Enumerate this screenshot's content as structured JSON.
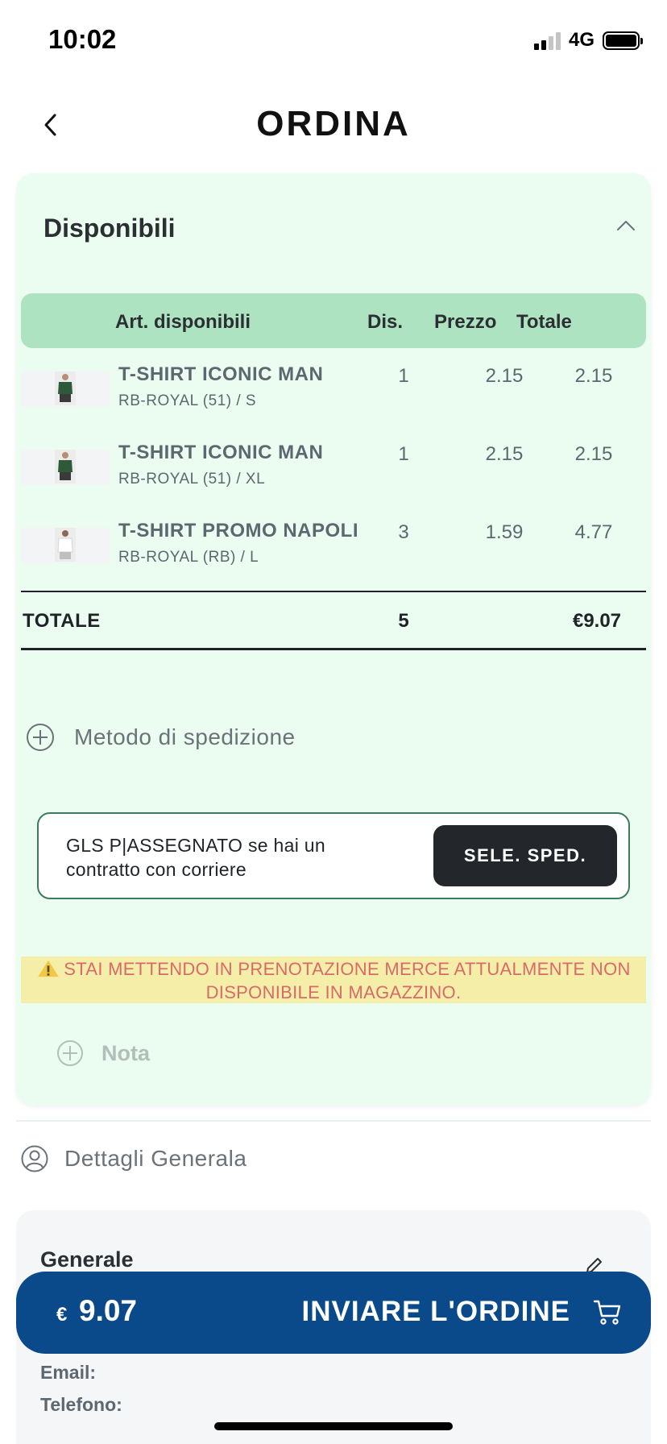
{
  "status_bar": {
    "time": "10:02",
    "network": "4G"
  },
  "header": {
    "title": "ORDINA"
  },
  "available": {
    "section_title": "Disponibili",
    "columns": {
      "article": "Art. disponibili",
      "dis": "Dis.",
      "price": "Prezzo",
      "total": "Totale"
    },
    "rows": [
      {
        "name": "T-SHIRT ICONIC MAN",
        "variant": "RB-ROYAL  (51) / S",
        "dis": "1",
        "price": "2.15",
        "total": "2.15"
      },
      {
        "name": "T-SHIRT ICONIC MAN",
        "variant": "RB-ROYAL  (51) / XL",
        "dis": "1",
        "price": "2.15",
        "total": "2.15"
      },
      {
        "name": "T-SHIRT PROMO NAPOLI",
        "variant": "RB-ROYAL  (RB) / L",
        "dis": "3",
        "price": "1.59",
        "total": "4.77"
      }
    ],
    "totals": {
      "label": "TOTALE",
      "qty": "5",
      "amount": "€9.07"
    }
  },
  "shipping": {
    "method_label": "Metodo di spedizione",
    "selected_text": "GLS P|ASSEGNATO se hai un contratto con corriere",
    "select_button": "SELE. SPED."
  },
  "warning": {
    "text": "STAI METTENDO IN PRENOTAZIONE MERCE ATTUALMENTE NON DISPONIBILE IN MAGAZZINO."
  },
  "note": {
    "label": "Nota"
  },
  "details": {
    "label": "Dettagli Generala",
    "card_title": "Generale",
    "email_label": "Email:",
    "phone_label": "Telefono:"
  },
  "order_bar": {
    "currency": "€",
    "amount": "9.07",
    "button_label": "INVIARE L'ORDINE"
  },
  "colors": {
    "card_bg": "#ebfdf0",
    "table_header": "#aee3c1",
    "primary_blue": "#0a4a8a",
    "warning_bg": "#f5eea8",
    "warning_text": "#d86a6a",
    "dark_button": "#23272b"
  }
}
